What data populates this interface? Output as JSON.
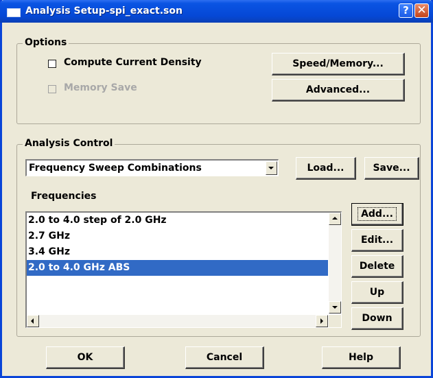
{
  "window": {
    "title": "Analysis Setup-spi_exact.son"
  },
  "titlebar": {
    "help_label": "?",
    "close_label": "✕"
  },
  "options": {
    "legend": "Options",
    "compute_current_density": {
      "label": "Compute Current Density",
      "checked": false
    },
    "memory_save": {
      "label": "Memory Save",
      "checked": false,
      "enabled": false
    },
    "speed_memory_label": "Speed/Memory...",
    "advanced_label": "Advanced..."
  },
  "analysis_control": {
    "legend": "Analysis Control",
    "sweep_type": "Frequency Sweep Combinations",
    "load_label": "Load...",
    "save_label": "Save...",
    "frequencies_label": "Frequencies",
    "frequencies": [
      "2.0 to 4.0 step of 2.0 GHz",
      "2.7 GHz",
      "3.4 GHz",
      "2.0 to 4.0 GHz ABS"
    ],
    "selected_index": 3,
    "add_label": "Add...",
    "edit_label": "Edit...",
    "delete_label": "Delete",
    "up_label": "Up",
    "down_label": "Down"
  },
  "footer": {
    "ok_label": "OK",
    "cancel_label": "Cancel",
    "help_label": "Help"
  },
  "colors": {
    "dialog_background": "#ece9d8",
    "titlebar_blue": "#0548d6",
    "selection": "#316ac5"
  }
}
